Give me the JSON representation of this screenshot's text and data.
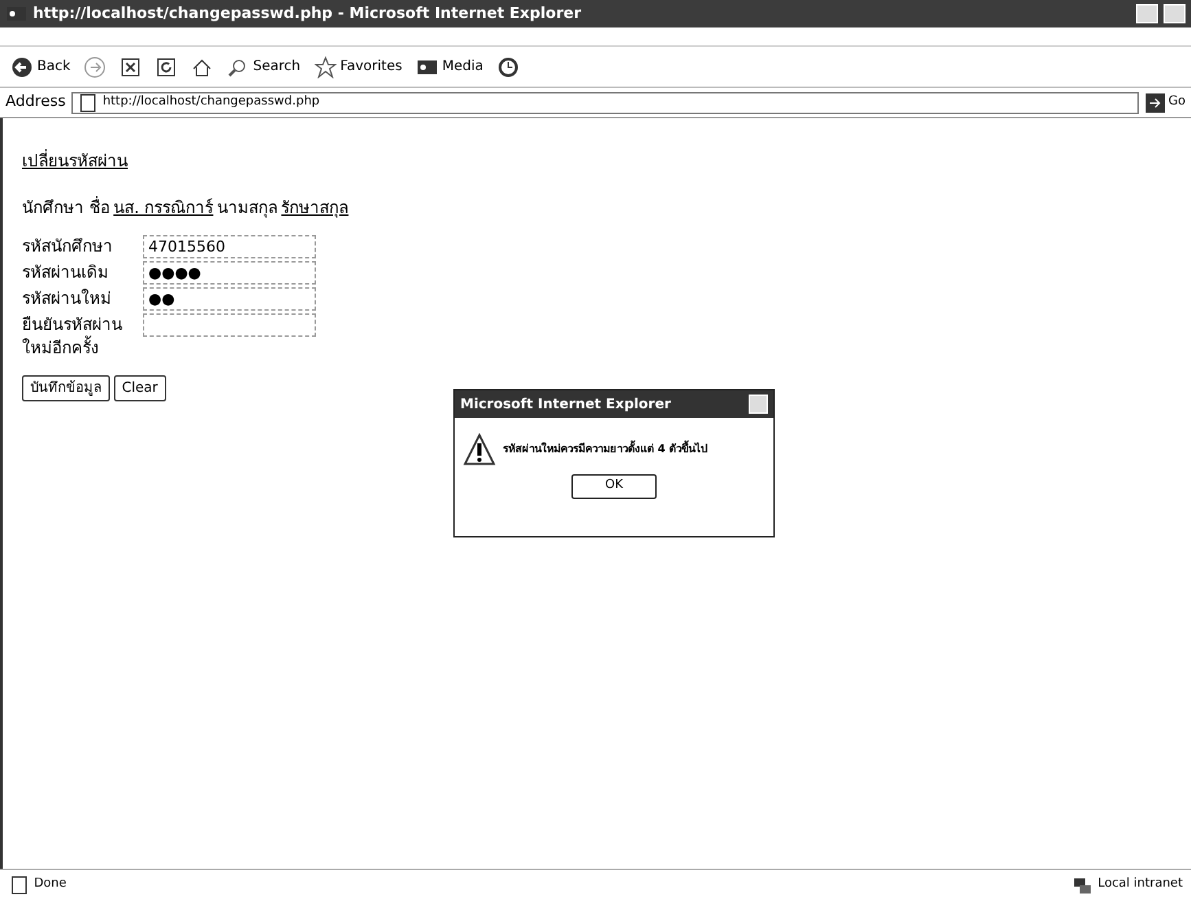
{
  "window": {
    "title": "http://localhost/changepasswd.php - Microsoft Internet Explorer"
  },
  "toolbar": {
    "buttons": [
      {
        "kind": "back",
        "label": "Back"
      },
      {
        "kind": "forward"
      },
      {
        "kind": "stop"
      },
      {
        "kind": "refresh"
      },
      {
        "kind": "home"
      },
      {
        "kind": "search",
        "label": "Search"
      },
      {
        "kind": "favorites",
        "label": "Favorites"
      },
      {
        "kind": "media",
        "label": "Media"
      },
      {
        "kind": "history"
      }
    ]
  },
  "address_bar": {
    "label": "Address",
    "url": "http://localhost/changepasswd.php",
    "go": "Go"
  },
  "page": {
    "heading": "เปลี่ยนรหัสผ่าน",
    "student_line": [
      {
        "text": "นักศึกษา ชื่อ",
        "link": false
      },
      {
        "text": "นส. กรรณิการ์",
        "link": true
      },
      {
        "text": "นามสกุล",
        "link": false
      },
      {
        "text": "รักษาสกุล",
        "link": true
      }
    ],
    "fields": [
      {
        "label": "รหัสนักศึกษา",
        "value": "47015560"
      },
      {
        "label": "รหัสผ่านเดิม",
        "value": "●●●●"
      },
      {
        "label": "รหัสผ่านใหม่",
        "value": "●●"
      },
      {
        "label": "ยืนยันรหัสผ่านใหม่อีกครั้ง"
      }
    ],
    "buttons": [
      "บันทึกข้อมูล",
      "Clear"
    ]
  },
  "dialog": {
    "title": "Microsoft Internet Explorer",
    "message": "รหัสผ่านใหม่ควรมีความยาวตั้งแต่ 4 ตัวขึ้นไป",
    "button": "OK"
  },
  "status_bar": {
    "status": "Done",
    "zone": "Local intranet"
  }
}
